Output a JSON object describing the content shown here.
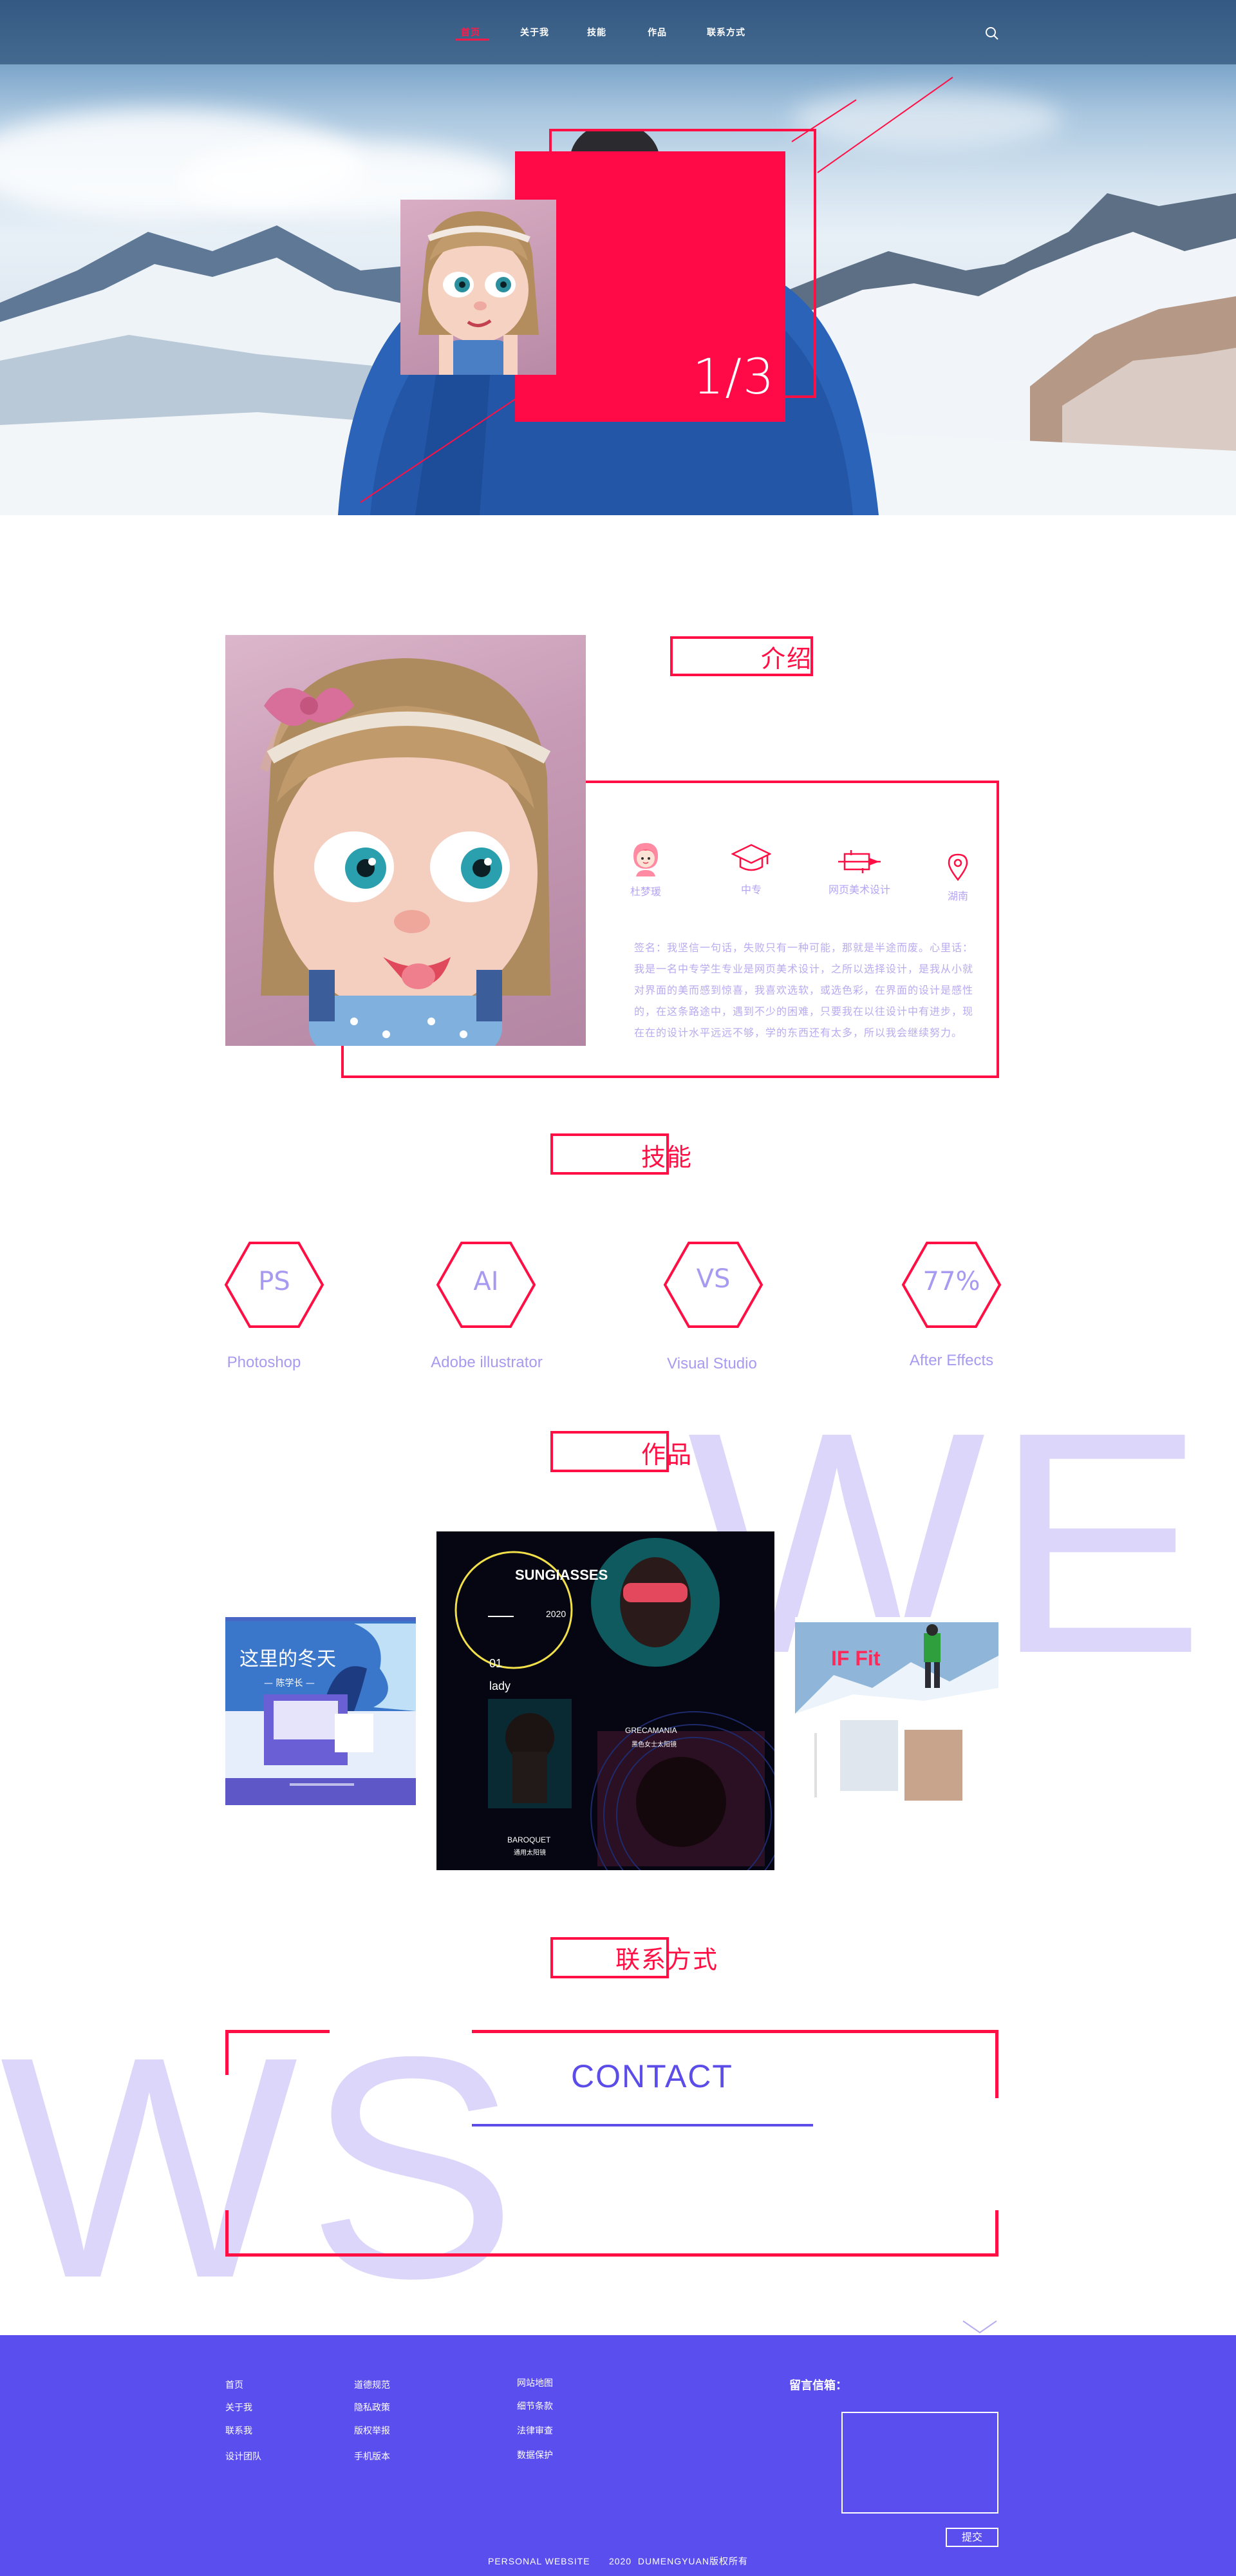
{
  "nav": {
    "items": [
      "首页",
      "关于我",
      "技能",
      "作品",
      "联系方式"
    ],
    "active_index": 0
  },
  "hero": {
    "counter": "1/3"
  },
  "intro": {
    "title": "介绍",
    "info": [
      {
        "icon": "girl-avatar-icon",
        "label": "杜梦瑗"
      },
      {
        "icon": "graduation-cap-icon",
        "label": "中专"
      },
      {
        "icon": "pen-tool-icon",
        "label": "网页美术设计"
      },
      {
        "icon": "location-pin-icon",
        "label": "湖南"
      }
    ],
    "text": "签名：我坚信一句话，失败只有一种可能，那就是半途而废。心里话：我是一名中专学生专业是网页美术设计，之所以选择设计，是我从小就对界面的美而感到惊喜，我喜欢选软，或选色彩，在界面的设计是感性的，在这条路途中，遇到不少的困难，只要我在以往设计中有进步，现在在的设计水平远远不够，学的东西还有太多，所以我会继续努力。"
  },
  "skills": {
    "title": "技能",
    "items": [
      {
        "abbr": "PS",
        "name": "Photoshop"
      },
      {
        "abbr": "AI",
        "name": "Adobe illustrator"
      },
      {
        "abbr": "VS",
        "name": "Visual Studio"
      },
      {
        "abbr": "77%",
        "name": "After Effects"
      }
    ]
  },
  "works": {
    "title": "作品",
    "bg_text": "WE",
    "left": {
      "headline": "这里的冬天",
      "sub": "— 陈学长 —"
    },
    "center": {
      "headline": "SUNGIASSES",
      "year": "2020",
      "number": "01",
      "tag": "lady",
      "caption1": "GRECAMANIA",
      "caption1_sub": "黑色女士太阳镜",
      "caption2": "BAROQUET",
      "caption2_sub": "通用太阳镜"
    },
    "right": {
      "headline": "IF Fit"
    }
  },
  "contact": {
    "title": "联系方式",
    "heading": "CONTACT",
    "bg_text": "WS"
  },
  "footer": {
    "col1": [
      "首页",
      "关于我",
      "联系我",
      "设计团队"
    ],
    "col2": [
      "道德规范",
      "隐私政策",
      "版权举报",
      "手机版本"
    ],
    "col3": [
      "网站地图",
      "细节条款",
      "法律审查",
      "数据保护"
    ],
    "message_label": "留言信箱：",
    "submit_label": "提交",
    "copyright": "PERSONAL WEBSITE      2020  DUMENGYUAN版权所有"
  },
  "colors": {
    "accent": "#ff0f44",
    "purple": "#5b4eee",
    "lavender": "#b8abef"
  }
}
